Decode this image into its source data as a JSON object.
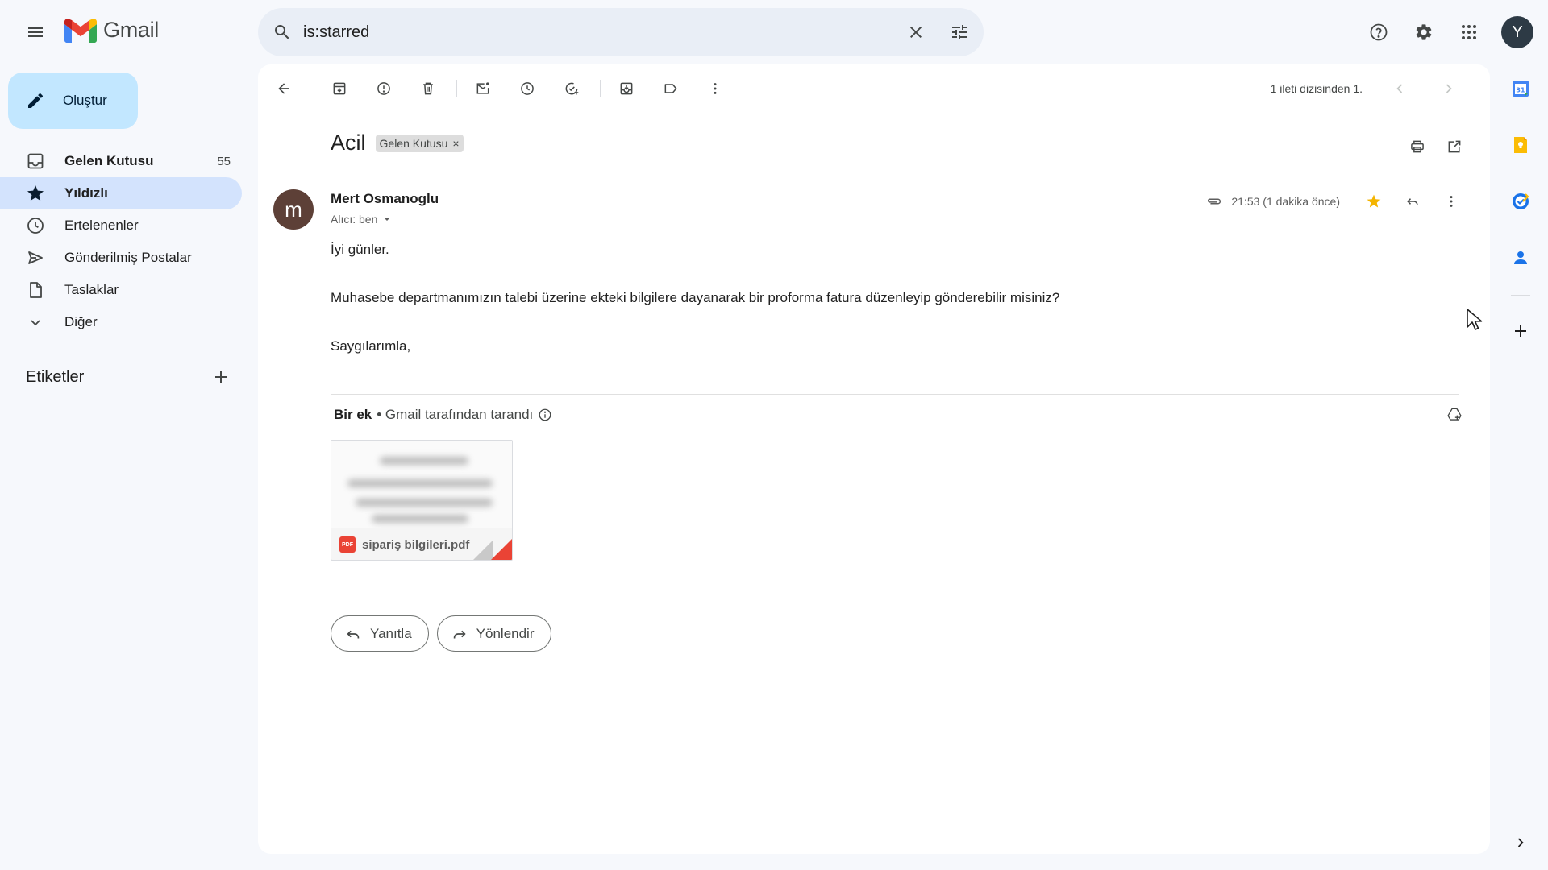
{
  "header": {
    "app_name": "Gmail",
    "search_value": "is:starred",
    "avatar_letter": "Y"
  },
  "compose": {
    "label": "Oluştur"
  },
  "nav": [
    {
      "label": "Gelen Kutusu",
      "count": "55",
      "icon": "inbox-icon",
      "bold": true
    },
    {
      "label": "Yıldızlı",
      "count": "",
      "icon": "star-icon",
      "active": true
    },
    {
      "label": "Ertelenenler",
      "count": "",
      "icon": "clock-icon"
    },
    {
      "label": "Gönderilmiş Postalar",
      "count": "",
      "icon": "send-icon"
    },
    {
      "label": "Taslaklar",
      "count": "",
      "icon": "file-icon"
    },
    {
      "label": "Diğer",
      "count": "",
      "icon": "chevron-down-icon"
    }
  ],
  "labels": {
    "title": "Etiketler"
  },
  "toolbar": {
    "pager_text": "1 ileti dizisinden 1."
  },
  "email": {
    "subject": "Acil",
    "label_chip": "Gelen Kutusu",
    "sender_initial": "m",
    "sender_name": "Mert Osmanoglu",
    "recipient": "Alıcı: ben",
    "timestamp": "21:53 (1 dakika önce)",
    "body": [
      "İyi günler.",
      "Muhasebe departmanımızın talebi üzerine ekteki bilgilere dayanarak bir proforma fatura düzenleyip gönderebilir misiniz?",
      "Saygılarımla,"
    ],
    "attachment": {
      "header_title": "Bir ek",
      "scan_text": "• Gmail tarafından tarandı",
      "file_name": "sipariş bilgileri.pdf",
      "badge": "PDF"
    },
    "reply_label": "Yanıtla",
    "forward_label": "Yönlendir"
  },
  "colors": {
    "background": "#f6f8fc",
    "compose_bg": "#c2e7ff",
    "active_nav_bg": "#d3e3fd",
    "star": "#f4b400",
    "pdf_red": "#ea4335",
    "sender_avatar": "#5d4037"
  },
  "side_panel": [
    "calendar-icon",
    "keep-icon",
    "tasks-icon",
    "contacts-icon",
    "add-icon"
  ]
}
